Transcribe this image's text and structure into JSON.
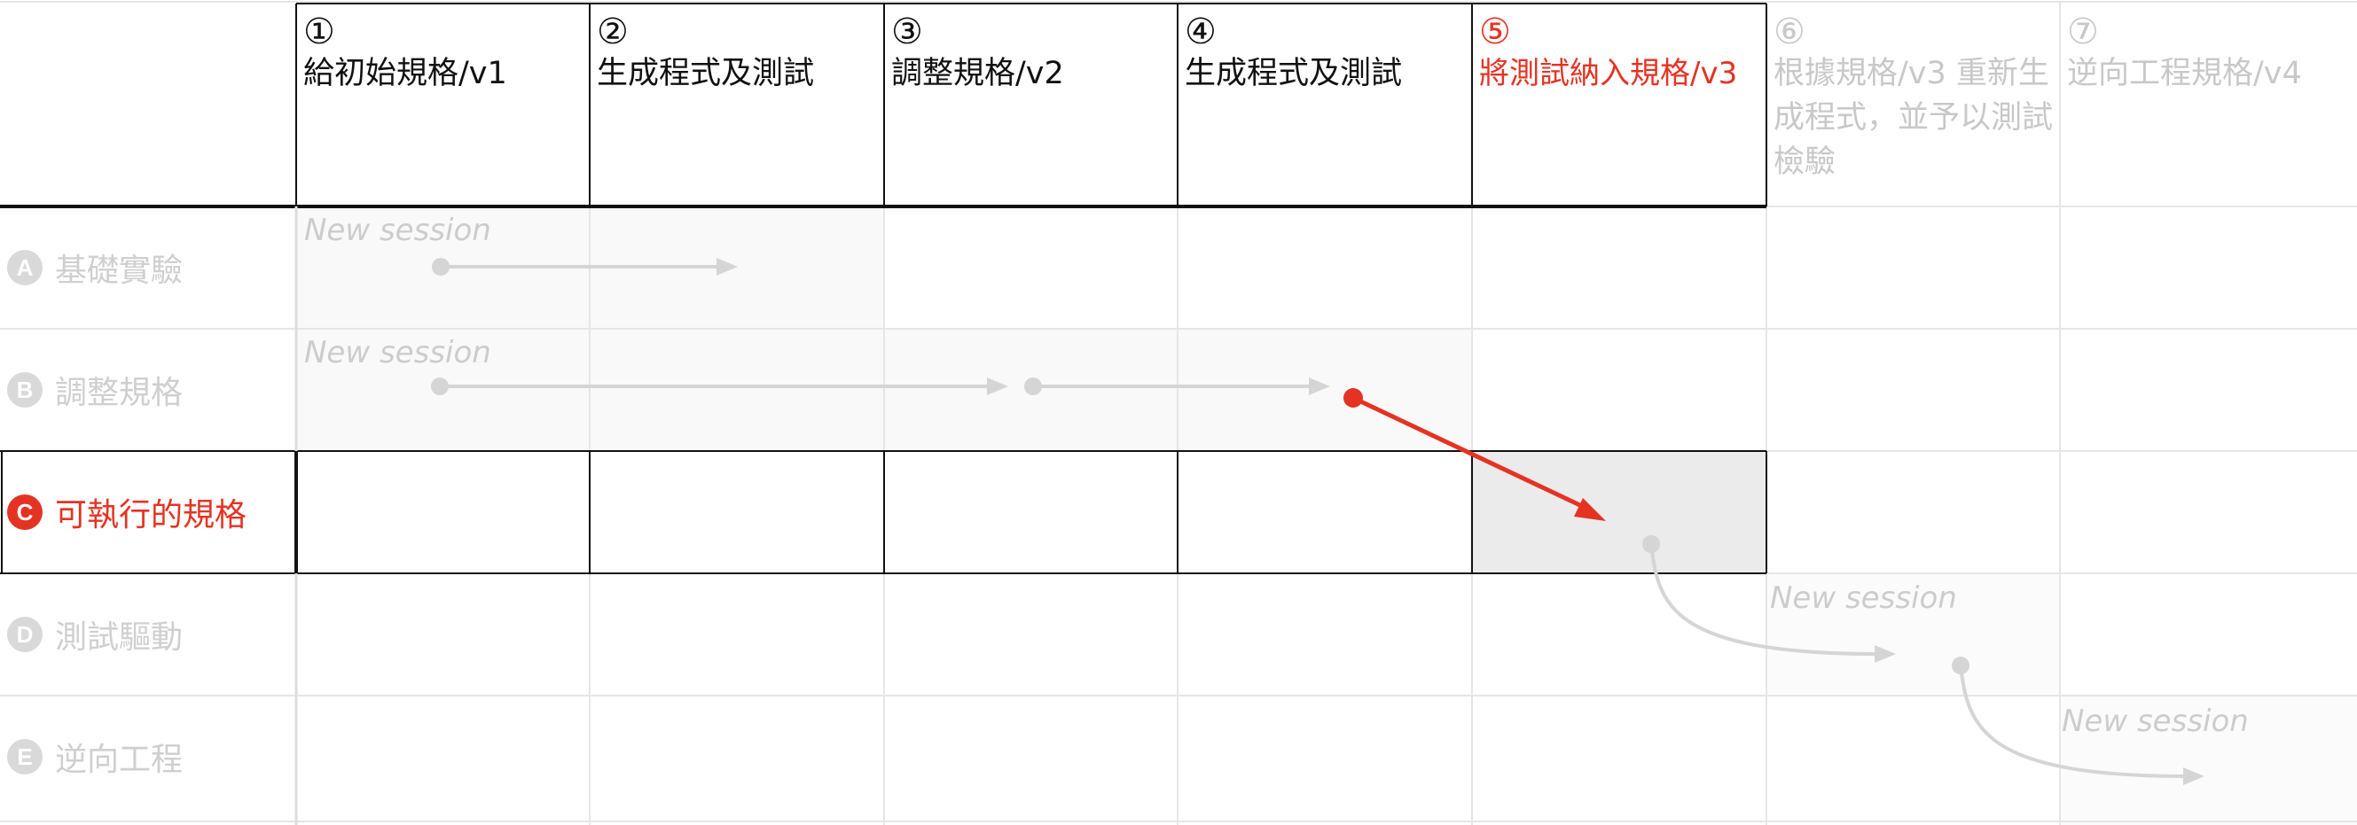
{
  "columns": [
    {
      "number": "①",
      "title": "給初始規格/v1",
      "state": "black"
    },
    {
      "number": "②",
      "title": "生成程式及測試",
      "state": "black"
    },
    {
      "number": "③",
      "title": "調整規格/v2",
      "state": "black"
    },
    {
      "number": "④",
      "title": "生成程式及測試",
      "state": "black"
    },
    {
      "number": "⑤",
      "title": "將測試納入規格/v3",
      "state": "red"
    },
    {
      "number": "⑥",
      "title": "根據規格/v3 重新生成程式，並予以測試檢驗",
      "state": "faded"
    },
    {
      "number": "⑦",
      "title": "逆向工程規格/v4",
      "state": "faded"
    }
  ],
  "rows": [
    {
      "badge": "A",
      "label": "基礎實驗",
      "state": "faded"
    },
    {
      "badge": "B",
      "label": "調整規格",
      "state": "faded"
    },
    {
      "badge": "C",
      "label": "可執行的規格",
      "state": "active"
    },
    {
      "badge": "D",
      "label": "測試驅動",
      "state": "faded"
    },
    {
      "badge": "E",
      "label": "逆向工程",
      "state": "faded"
    }
  ],
  "sessions": [
    {
      "row": "A",
      "text": "New session"
    },
    {
      "row": "B",
      "text": "New session"
    },
    {
      "row": "D",
      "text": "New session"
    },
    {
      "row": "E",
      "text": "New session"
    }
  ],
  "colors": {
    "accent_red": "#e53323",
    "faded_text": "#cccccc",
    "grid_line": "#e6e6e6",
    "dark_line": "#111111",
    "highlight_cell": "#ebebeb",
    "session_bg": "#f9f9f9",
    "faded_arrow": "#d5d5d5"
  },
  "icons": {
    "connector_dot": "dot-icon",
    "arrow_head": "arrowhead-icon"
  }
}
